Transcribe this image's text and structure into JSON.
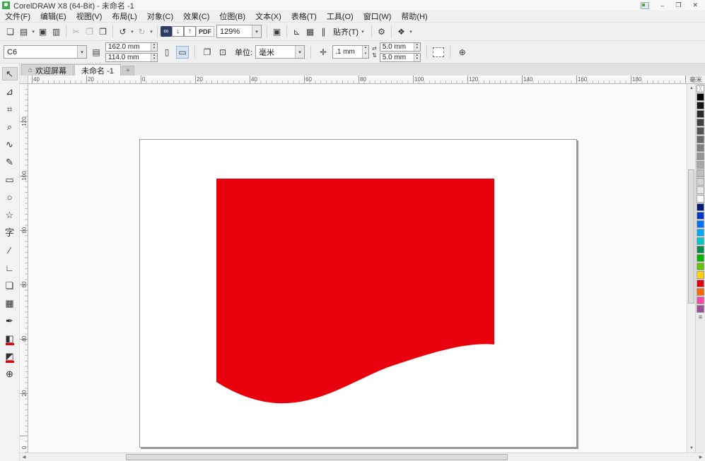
{
  "titlebar": {
    "title": "CorelDRAW X8 (64-Bit) - 未命名 -1",
    "minimize_glyph": "–",
    "restore_glyph": "❐",
    "close_glyph": "✕"
  },
  "menubar": {
    "items": [
      "文件(F)",
      "编辑(E)",
      "视图(V)",
      "布局(L)",
      "对象(C)",
      "效果(C)",
      "位图(B)",
      "文本(X)",
      "表格(T)",
      "工具(O)",
      "窗口(W)",
      "帮助(H)"
    ]
  },
  "toolbar": {
    "glyphs": {
      "new_doc": "❏",
      "open": "▤",
      "save": "▣",
      "print": "▥",
      "cut": "✂",
      "copy": "❐",
      "paste": "❒",
      "undo": "↺",
      "redo": "↻",
      "search": "∞",
      "import": "↓",
      "export": "↑",
      "fullscreen": "▣",
      "rulers": "⊾",
      "grid": "▦",
      "guidelines": "∥",
      "options": "⚙",
      "launcher": "❖",
      "caret": "▾"
    },
    "pdf_label": "PDF",
    "zoom_value": "129%",
    "snap_label": "贴齐(T)"
  },
  "propertybar": {
    "preset_value": "C6",
    "width_value": "162.0 mm",
    "height_value": "114.0 mm",
    "units_label": "单位:",
    "units_value": "毫米",
    "nudge_value": ".1 mm",
    "dup_x_value": "5.0 mm",
    "dup_y_value": "5.0 mm",
    "glyphs": {
      "page_size": "▤",
      "portrait": "▯",
      "landscape": "▭",
      "all_pages": "❐",
      "current_page": "⊡",
      "nudge": "✛",
      "dup_h": "⇄",
      "dup_v": "⇅",
      "quick_customize": "⊕",
      "spin_up": "▴",
      "spin_down": "▾"
    }
  },
  "tabbar": {
    "home_glyph": "⌂",
    "welcome_label": "欢迎屏幕",
    "doc_label": "未命名 -1",
    "new_tab_label": "+"
  },
  "rulers": {
    "unit_label": "毫米",
    "h_labels": [
      "40",
      "20",
      "0",
      "20",
      "40",
      "60",
      "80",
      "100",
      "120",
      "140",
      "160",
      "180"
    ],
    "v_labels": [
      "120",
      "100",
      "80",
      "60",
      "40",
      "20",
      "0"
    ]
  },
  "toolbox": {
    "glyphs": [
      "↖",
      "⊿",
      "⌗",
      "⌕",
      "∿",
      "✎",
      "▭",
      "○",
      "☆",
      "字",
      "∕",
      "∟",
      "❏",
      "▦",
      "✒",
      "◧",
      "◩",
      "⊕"
    ]
  },
  "canvas": {
    "shape_color": "#e8000d"
  },
  "palette": {
    "no_fill_glyph": "╳",
    "overflow_glyph": "≡",
    "colors": [
      "#000000",
      "#161616",
      "#2b2b2b",
      "#404040",
      "#555555",
      "#6a6a6a",
      "#808080",
      "#959595",
      "#aaaaaa",
      "#bfbfbf",
      "#d4d4d4",
      "#e9e9e9",
      "#ffffff",
      "#001d7d",
      "#0038cc",
      "#0070ff",
      "#00a8ff",
      "#00c8c8",
      "#008c50",
      "#00b400",
      "#66c400",
      "#ffd400",
      "#e8000d",
      "#ff6600",
      "#ff47a3",
      "#9b4f96"
    ]
  },
  "scrollbars": {
    "up": "▲",
    "down": "▼",
    "left": "◀",
    "right": "▶"
  }
}
